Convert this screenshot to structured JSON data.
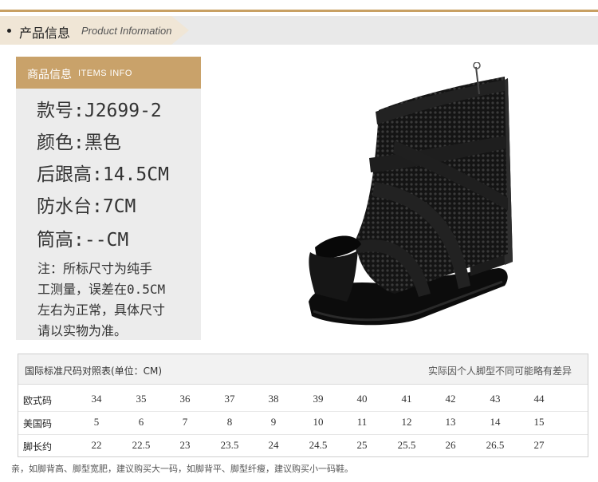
{
  "header": {
    "title_cn": "产品信息",
    "title_en": "Product Information"
  },
  "info": {
    "title_cn": "商品信息",
    "title_en": "ITEMS INFO",
    "lines": [
      "款号:J2699-2",
      "颜色:黑色",
      "后跟高:14.5CM",
      "防水台:7CM",
      "筒高:--CM"
    ],
    "note": [
      "注：所标尺寸为纯手",
      "工测量，误差在0.5CM",
      "左右为正常，具体尺寸",
      "请以实物为准。"
    ]
  },
  "size_table": {
    "title": "国际标准尺码对照表(单位：CM)",
    "right_note": "实际因个人脚型不同可能略有差异",
    "rows": [
      {
        "label": "欧式码",
        "values": [
          "34",
          "35",
          "36",
          "37",
          "38",
          "39",
          "40",
          "41",
          "42",
          "43",
          "44"
        ]
      },
      {
        "label": "美国码",
        "values": [
          "5",
          "6",
          "7",
          "8",
          "9",
          "10",
          "11",
          "12",
          "13",
          "14",
          "15"
        ]
      },
      {
        "label": "脚长约",
        "values": [
          "22",
          "22.5",
          "23",
          "23.5",
          "24",
          "24.5",
          "25",
          "25.5",
          "26",
          "26.5",
          "27"
        ]
      }
    ]
  },
  "footnote": "亲，如脚背高、脚型宽肥，建议购买大一码，如脚背平、脚型纤瘦，建议购买小一码鞋。",
  "colors": {
    "accent": "#c9a26a",
    "panel_bg": "#ececec",
    "header_bg": "#e9e9e9"
  }
}
